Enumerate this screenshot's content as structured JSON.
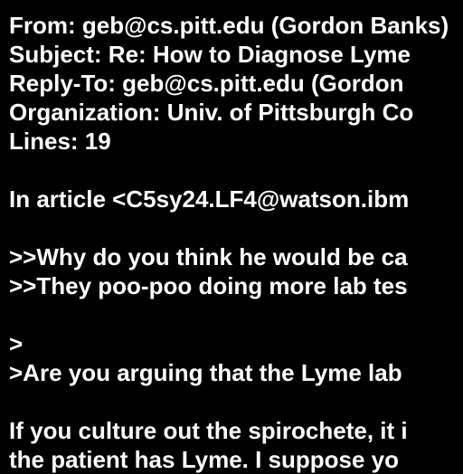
{
  "text_color": "#ffffff",
  "background_color": "#000000",
  "lines": [
    "From: geb@cs.pitt.edu (Gordon Banks)",
    "Subject: Re: How to Diagnose Lyme",
    "Reply-To: geb@cs.pitt.edu (Gordon",
    "Organization: Univ. of Pittsburgh Co",
    "Lines: 19",
    "",
    "In article <C5sy24.LF4@watson.ibm",
    "",
    ">>Why do you think he would be ca",
    ">>They poo-poo doing more lab tes",
    "",
    ">",
    ">Are you arguing that the Lyme lab",
    "",
    "If you culture out the spirochete, it i",
    "the patient has Lyme. I suppose yo"
  ]
}
